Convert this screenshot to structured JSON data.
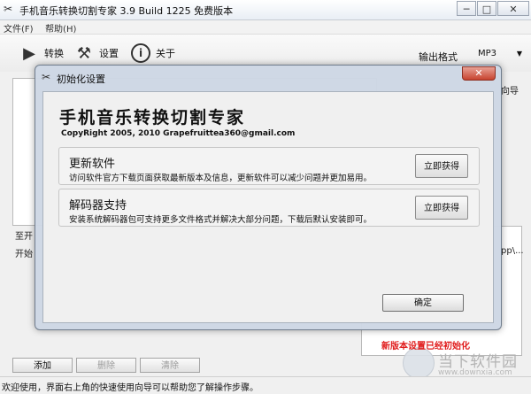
{
  "window": {
    "title": "手机音乐转换切割专家 3.9 Build 1225 免费版本",
    "minimize": "─",
    "maximize": "□",
    "close": "✕"
  },
  "menu": {
    "items": [
      "文件(F)",
      "帮助(H)"
    ]
  },
  "toolbar": {
    "convert_label": "转换",
    "settings_label": "设置",
    "about_label": "关于",
    "output_format_label": "输出格式",
    "output_format_value": "MP3"
  },
  "background": {
    "help_link_fragment": "向导",
    "row_label_a": "至开",
    "row_label_b": "开始",
    "path_fragment": "pp\\..."
  },
  "bottom_buttons": {
    "add": "添加",
    "delete": "删除",
    "clear": "清除"
  },
  "status": "欢迎使用，界面右上角的快速使用向导可以帮助您了解操作步骤。",
  "watermark": {
    "text": "当下软件园",
    "sub": "www.downxia.com"
  },
  "dialog": {
    "title": "初始化设置",
    "close": "✕",
    "product_name": "手机音乐转换切割专家",
    "copyright": "CopyRight 2005, 2010 Grapefruittea360@gmail.com",
    "groups": [
      {
        "title": "更新软件",
        "desc": "访问软件官方下载页面获取最新版本及信息，更新软件可以减少问题并更加易用。",
        "button": "立即获得"
      },
      {
        "title": "解码器支持",
        "desc": "安装系统解码器包可支持更多文件格式并解决大部分问题，下载后默认安装即可。",
        "button": "立即获得"
      }
    ],
    "notice": "新版本设置已经初始化",
    "ok_button": "确定"
  },
  "colors": {
    "notice_red": "#e01b1b",
    "dialog_frame": "#cdd7e4",
    "close_red": "#c7432f"
  },
  "icons": {
    "app": "scissors-icon",
    "convert": "play-triangle-icon",
    "settings": "tools-icon",
    "about": "info-icon"
  }
}
